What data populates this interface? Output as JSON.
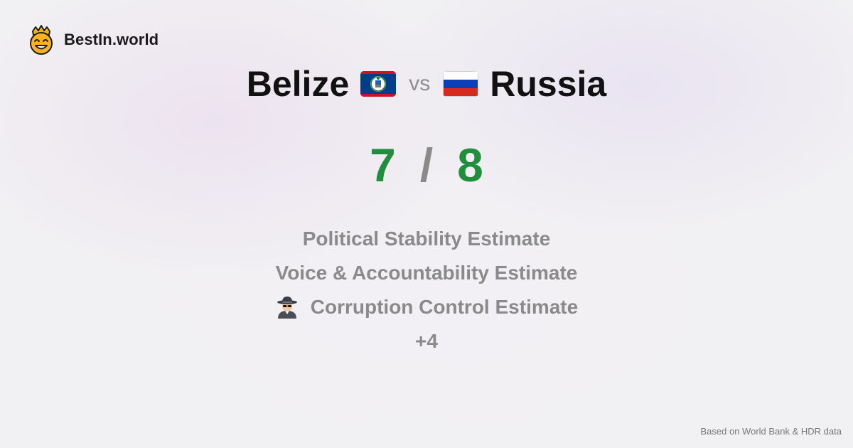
{
  "brand": {
    "name": "BestIn.world",
    "logo_icon": "crowned-smiley-icon"
  },
  "comparison": {
    "left_country": "Belize",
    "left_flag": "belize-flag-icon",
    "vs_label": "vs",
    "right_country": "Russia",
    "right_flag": "russia-flag-icon"
  },
  "score": {
    "left": "7",
    "separator": "/",
    "right": "8"
  },
  "metrics": [
    {
      "label": "Political Stability Estimate"
    },
    {
      "label": "Voice & Accountability Estimate"
    },
    {
      "label": "Corruption Control Estimate",
      "icon": "spy-icon"
    }
  ],
  "more_label": "+4",
  "footer": {
    "source": "Based on World Bank & HDR data"
  },
  "colors": {
    "score_green": "#1f8f3b",
    "muted_gray": "#8a8a8a",
    "background": "#f1f0f2"
  }
}
